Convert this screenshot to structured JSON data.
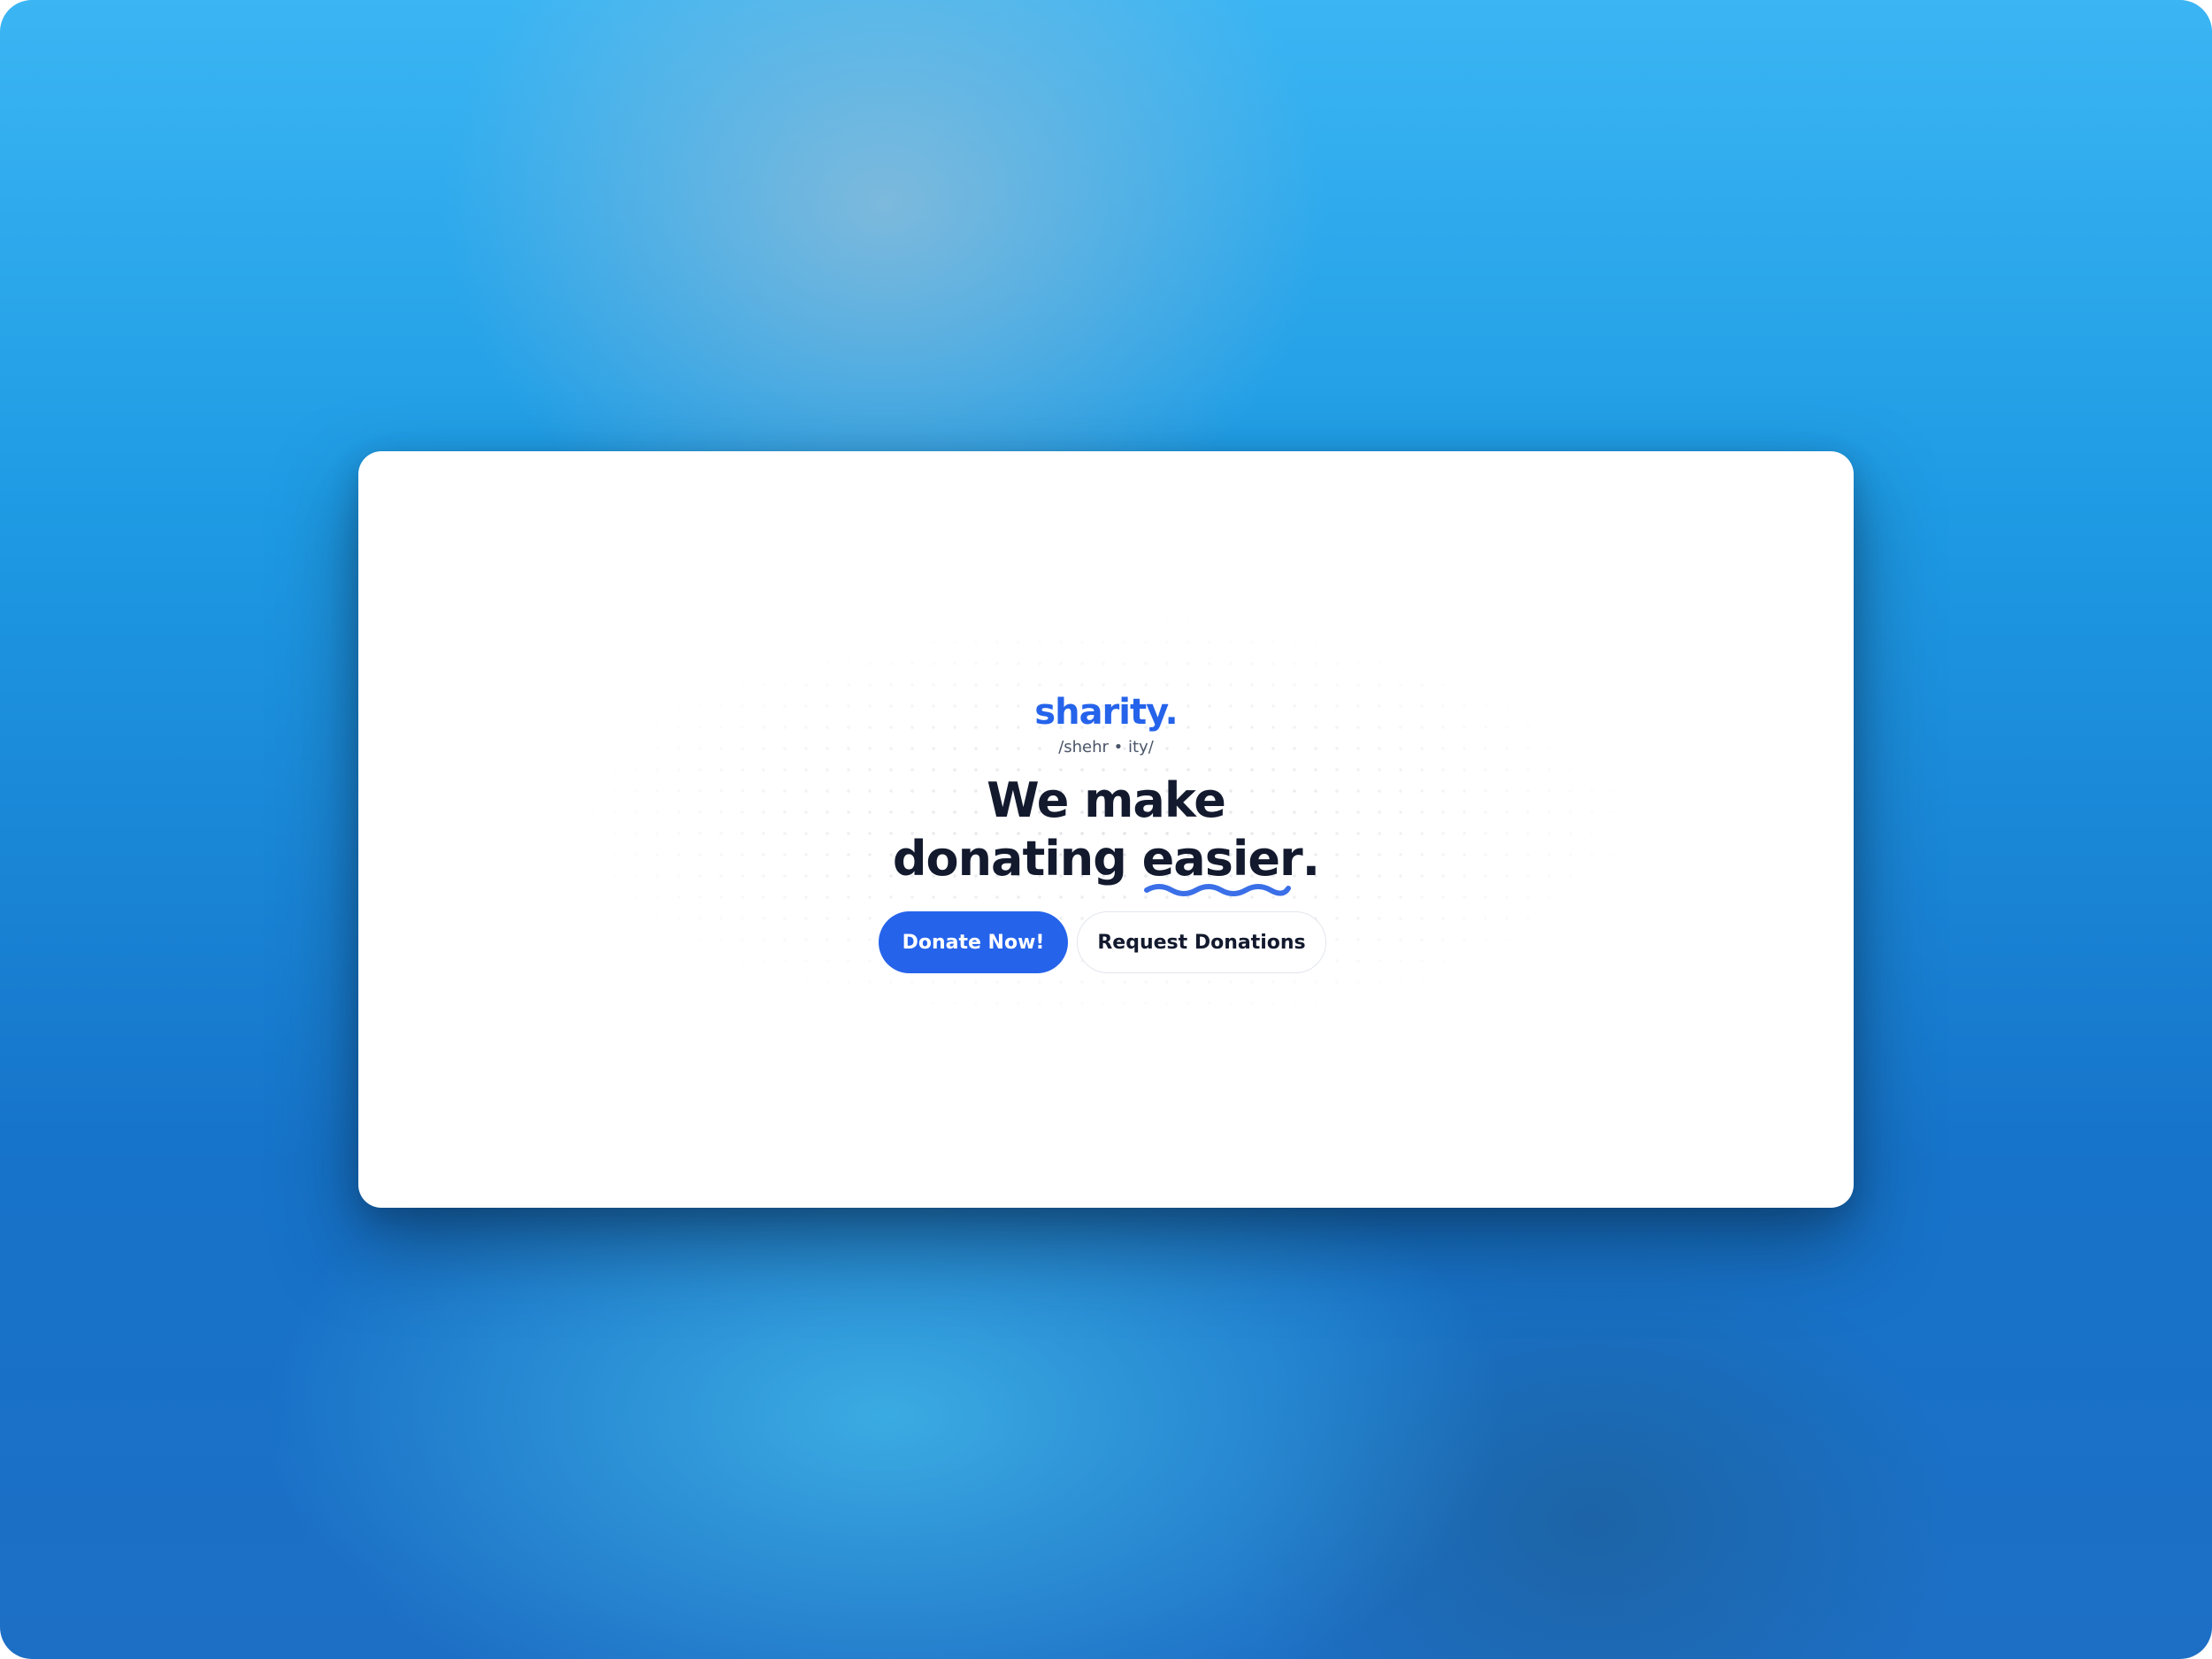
{
  "brand": {
    "name": "sharity.",
    "pronunciation": "/shehr • ity/"
  },
  "hero": {
    "headline_line1": "We make",
    "headline_line2_prefix": "donating ",
    "headline_emphasis": "easier",
    "headline_suffix": "."
  },
  "actions": {
    "primary_label": "Donate Now!",
    "secondary_label": "Request Donations"
  },
  "colors": {
    "accent": "#2563eb",
    "text": "#131a2e",
    "muted": "#4a5568"
  }
}
